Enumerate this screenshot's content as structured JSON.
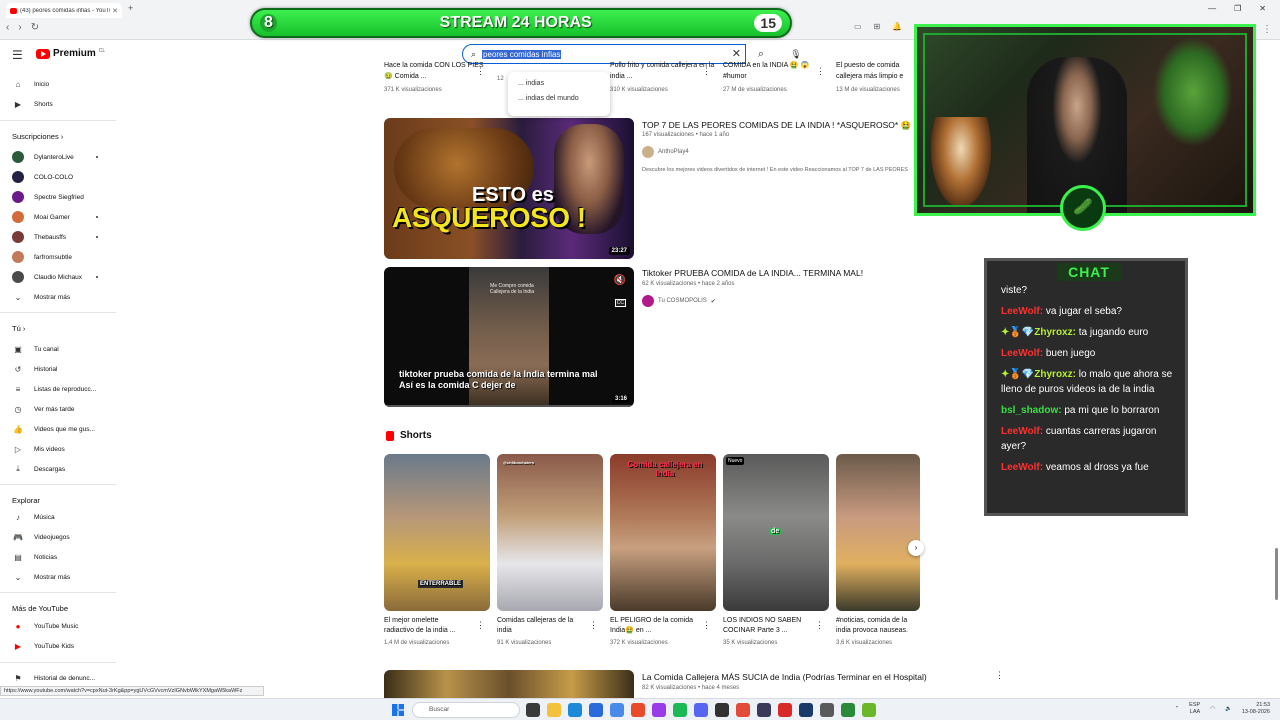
{
  "browser": {
    "tab_title": "(43) peores comidas infias - YouTube",
    "new_tab": "+",
    "win_controls": [
      "—",
      "❐",
      "✕"
    ],
    "status_url": "https://www.youtube.com/watch?v=cpxNut-3rKg&pp=ygUVcGVvcmVzIGNvbWlkYXMgaW5kaWFz"
  },
  "header": {
    "brand": "Premium",
    "region": "CL",
    "search_value": "peores comidas infias"
  },
  "search_suggestions": [
    "... indias",
    "... indias del mundo"
  ],
  "sidebar": {
    "top": [
      {
        "label": "Inicio",
        "icon": "home-icon"
      },
      {
        "label": "Shorts",
        "icon": "shorts-icon"
      }
    ],
    "subs_heading": "Suscripciones",
    "subs": [
      {
        "label": "DylanteroLive",
        "color": "#2d5a3a",
        "dot": true
      },
      {
        "label": "COLO-COLO",
        "color": "#222244",
        "dot": false
      },
      {
        "label": "Spectre Siegfried",
        "color": "#6a1a8a",
        "dot": false
      },
      {
        "label": "Moai Gamer",
        "color": "#d26a3a",
        "dot": true
      },
      {
        "label": "Thebausffs",
        "color": "#7a3a3a",
        "dot": true
      },
      {
        "label": "farfromsubtle",
        "color": "#c27a5a",
        "dot": false
      },
      {
        "label": "Claudio Michaux",
        "color": "#4a4a4a",
        "dot": true
      }
    ],
    "show_more": "Mostrar más",
    "you_heading": "Tú",
    "you": [
      {
        "label": "Tu canal",
        "icon": "channel-icon"
      },
      {
        "label": "Historial",
        "icon": "history-icon"
      },
      {
        "label": "Listas de reproducc...",
        "icon": "playlist-icon"
      },
      {
        "label": "Ver más tarde",
        "icon": "watch-later-icon"
      },
      {
        "label": "Videos que me gus...",
        "icon": "like-icon"
      },
      {
        "label": "Mis videos",
        "icon": "my-videos-icon"
      },
      {
        "label": "Descargas",
        "icon": "download-icon"
      }
    ],
    "explore_heading": "Explorar",
    "explore": [
      {
        "label": "Música",
        "icon": "music-icon"
      },
      {
        "label": "Videojuegos",
        "icon": "gaming-icon"
      },
      {
        "label": "Noticias",
        "icon": "news-icon"
      },
      {
        "label": "Mostrar más",
        "icon": "chevron-down-icon"
      }
    ],
    "more_heading": "Más de YouTube",
    "more": [
      {
        "label": "YouTube Music",
        "icon": "yt-music-icon"
      },
      {
        "label": "YouTube Kids",
        "icon": "yt-kids-icon"
      }
    ],
    "report": "Historial de denunc..."
  },
  "top_row": [
    {
      "title": "Hace la comida CON LOS PIES 🤢 Comida ...",
      "meta": "371 K visualizaciones"
    },
    {
      "title": "",
      "meta": "12"
    },
    {
      "title": "Pollo frito y comida callejera en la india ...",
      "meta": "310 K visualizaciones"
    },
    {
      "title": "COMIDA en la INDIA 🤮 😱 #humor",
      "meta": "27 M de visualizaciones"
    },
    {
      "title": "El puesto de comida callejera más limpio e",
      "meta": "13 M de visualizaciones"
    }
  ],
  "videos": [
    {
      "title": "TOP 7 DE LAS PEORES COMIDAS DE LA INDIA ! *ASQUEROSO* 🤮",
      "meta": "167 visualizaciones • hace 1 año",
      "channel": "AnthoPlay4",
      "desc": "Descubre los mejores videos divertidos de internet ! En este video Reaccionamos al TOP 7 de LAS PEORES",
      "duration": "23:27",
      "thumb_text_1": "ESTO es",
      "thumb_text_2": "ASQUEROSO !"
    },
    {
      "title": "Tiktoker PRUEBA COMIDA de LA INDIA... TERMINA MAL!",
      "meta": "62 K visualizaciones • hace 2 años",
      "channel": "Tu COSMOPOLIS",
      "duration": "3:16",
      "caption": "tiktoker prueba comida de la India termina mal Así es la comida C dejer de",
      "small_caption": "Me Compro comida Callejera de la India",
      "cc": "CC"
    },
    {
      "title": "La Comida Callejera MÁS SUCIA de India (Podrías Terminar en el Hospital)",
      "meta": "82 K visualizaciones • hace 4 meses"
    }
  ],
  "shorts": {
    "heading": "Shorts",
    "items": [
      {
        "title": "El mejor omelette radiactivo de la india ...",
        "meta": "1,4 M de visualizaciones",
        "label": "ENTERRABLE"
      },
      {
        "title": "Comidas callejeras de la india",
        "meta": "91 K visualizaciones",
        "label": "@chiltunchaiers"
      },
      {
        "title": "EL PELIGRO de la comida India🤮 en ...",
        "meta": "372 K visualizaciones",
        "label": "Comida callejera en India"
      },
      {
        "title": "LOS INDIOS NO SABEN COCINAR Parte 3 ...",
        "meta": "35 K visualizaciones",
        "label": "de",
        "badge": "Nuevo"
      },
      {
        "title": "#noticias, comida de la india provoca nauseas.",
        "meta": "3,6 K visualizaciones",
        "label": ""
      }
    ]
  },
  "stream": {
    "left_num": "8",
    "title": "STREAM 24 HORAS",
    "right_num": "15"
  },
  "chat": {
    "heading": "CHAT",
    "messages": [
      {
        "user": "",
        "text": "viste?",
        "color": "#ff4444"
      },
      {
        "user": "LeeWolf:",
        "text": "va jugar el seba?",
        "color": "#ff3030"
      },
      {
        "user": "✦🥉💎Zhyroxz:",
        "text": "ta jugando euro",
        "color": "#b4f032"
      },
      {
        "user": "LeeWolf:",
        "text": "buen juego",
        "color": "#ff3030"
      },
      {
        "user": "✦🥉💎Zhyroxz:",
        "text": "lo malo que ahora se lleno de puros videos ia de la india",
        "color": "#b4f032"
      },
      {
        "user": "bsl_shadow:",
        "text": "pa mi que lo borraron",
        "color": "#39e046"
      },
      {
        "user": "LeeWolf:",
        "text": "cuantas carreras jugaron ayer?",
        "color": "#ff3030"
      },
      {
        "user": "LeeWolf:",
        "text": "veamos al dross ya fue",
        "color": "#ff3030"
      }
    ]
  },
  "taskbar": {
    "search": "Buscar",
    "lang": "ESP",
    "lang2": "LAA",
    "time": "21:53",
    "date": "13-08-2026"
  }
}
